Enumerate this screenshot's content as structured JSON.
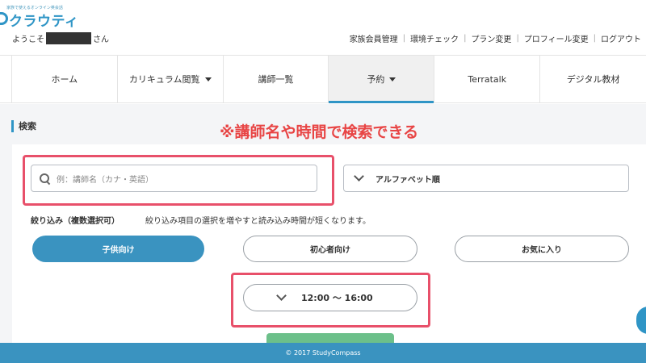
{
  "brand": {
    "tagline": "家族で使えるオンライン英会話",
    "name": "クラウティ"
  },
  "welcome": {
    "prefix": "ようこそ",
    "suffix": "さん"
  },
  "top_links": [
    "家族会員管理",
    "環境チェック",
    "プラン変更",
    "プロフィール変更",
    "ログアウト"
  ],
  "nav": [
    {
      "label": "ホーム",
      "dropdown": false,
      "active": false
    },
    {
      "label": "カリキュラム閲覧",
      "dropdown": true,
      "active": false
    },
    {
      "label": "講師一覧",
      "dropdown": false,
      "active": false
    },
    {
      "label": "予約",
      "dropdown": true,
      "active": true
    },
    {
      "label": "Terratalk",
      "dropdown": false,
      "active": false
    },
    {
      "label": "デジタル教材",
      "dropdown": false,
      "active": false
    }
  ],
  "search": {
    "title": "検索",
    "annotation": "※講師名や時間で検索できる",
    "input_placeholder": "例：講師名（カナ・英語）",
    "sort_value": "アルファベット順",
    "filter_label": "絞り込み（複数選択可）",
    "filter_note": "絞り込み項目の選択を増やすと読み込み時間が短くなります。",
    "filters": [
      {
        "label": "子供向け",
        "selected": true
      },
      {
        "label": "初心者向け",
        "selected": false
      },
      {
        "label": "お気に入り",
        "selected": false
      }
    ],
    "time_range": "12:00 ～ 16:00"
  },
  "footer": {
    "copyright": "© 2017 StudyCompass"
  },
  "colors": {
    "primary": "#2f95c6",
    "accent_red": "#e84545",
    "highlight_border": "#e8506a",
    "submit_green": "#6cc08a"
  }
}
